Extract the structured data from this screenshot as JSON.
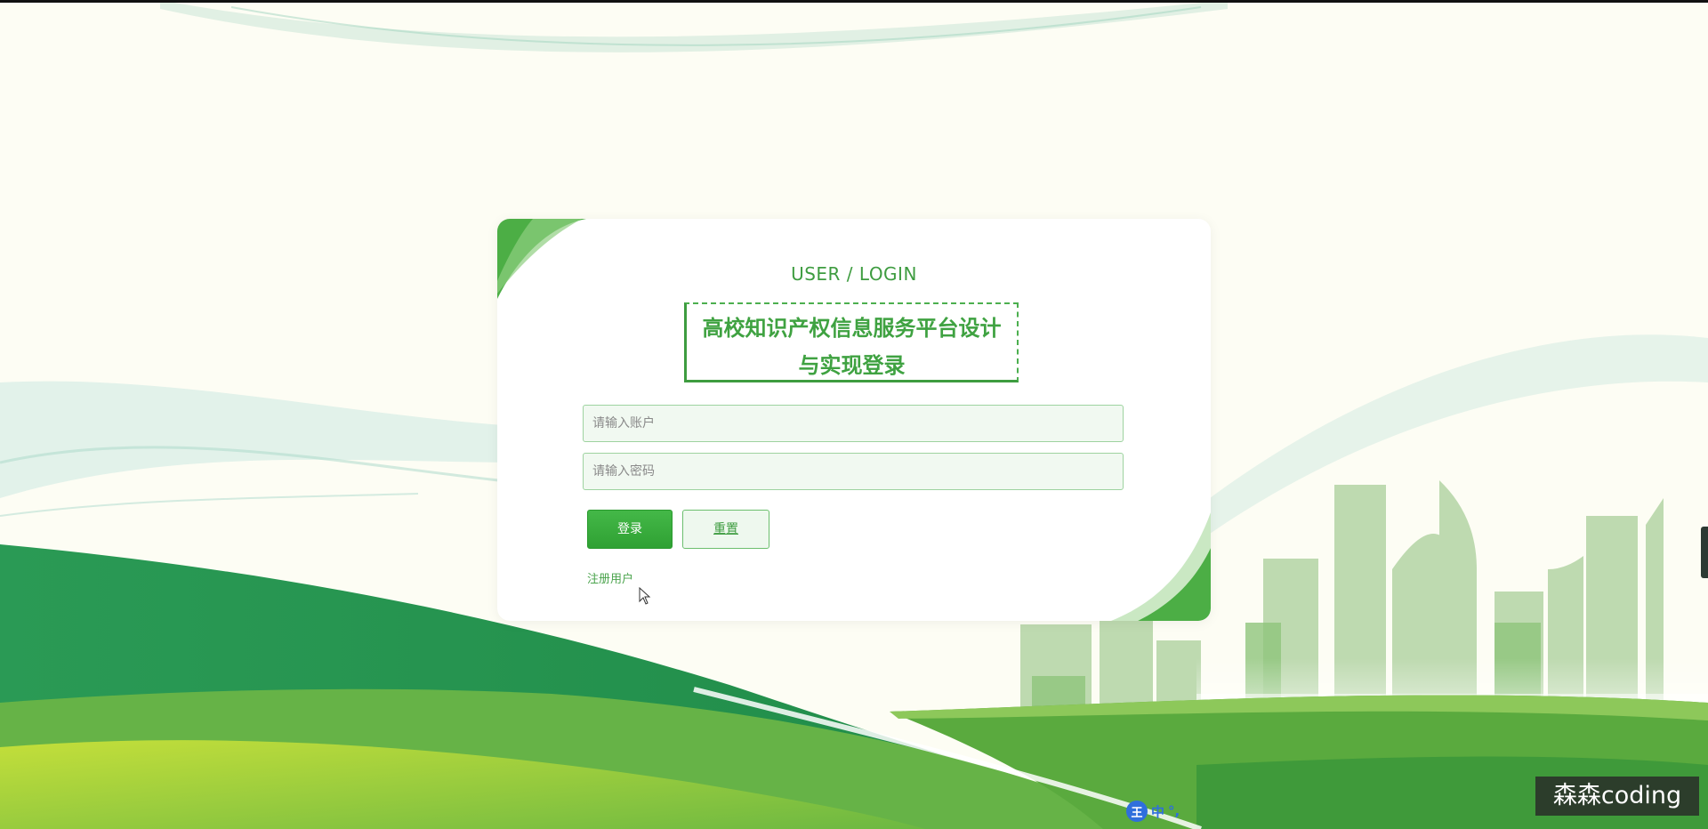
{
  "login": {
    "heading": "USER / LOGIN",
    "title_line1": "高校知识产权信息服务平台设计",
    "title_line2": "与实现登录",
    "username_placeholder": "请输入账户",
    "password_placeholder": "请输入密码",
    "login_button": "登录",
    "reset_button": "重置",
    "register_link": "注册用户"
  },
  "ime": {
    "logo": "王",
    "mode": "中",
    "punct": "°,"
  },
  "watermark": {
    "text": "森森coding"
  },
  "colors": {
    "accent": "#3fa241",
    "button_green": "#2fa133",
    "background": "#fdfdf4",
    "hill_dark": "#2a9a55",
    "hill_light": "#8cc63f"
  },
  "icons": {
    "cursor": "mouse-pointer-icon",
    "ime": "ime-logo-icon"
  }
}
